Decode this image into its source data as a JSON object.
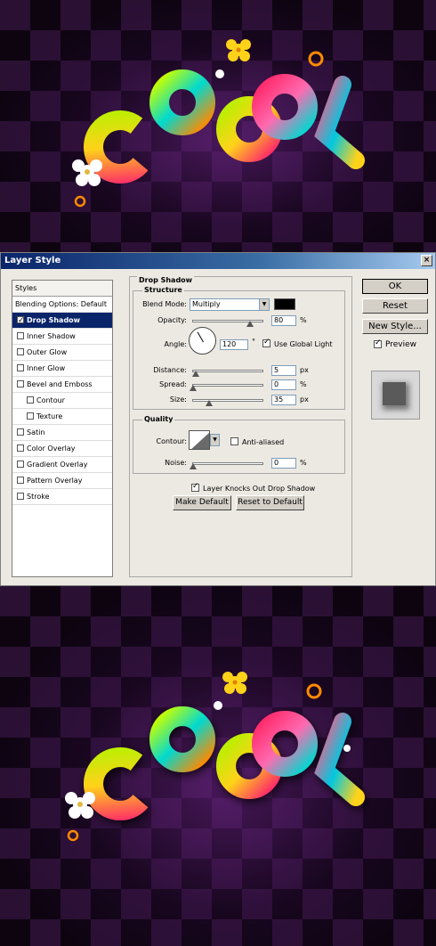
{
  "dialog": {
    "title": "Layer Style",
    "close_glyph": "×"
  },
  "styles_list": {
    "header": "Styles",
    "items": [
      {
        "label": "Blending Options: Default",
        "checkbox": false,
        "level": 0,
        "checked": false,
        "selected": false
      },
      {
        "label": "Drop Shadow",
        "checkbox": true,
        "level": 1,
        "checked": true,
        "selected": true
      },
      {
        "label": "Inner Shadow",
        "checkbox": true,
        "level": 1,
        "checked": false,
        "selected": false
      },
      {
        "label": "Outer Glow",
        "checkbox": true,
        "level": 1,
        "checked": false,
        "selected": false
      },
      {
        "label": "Inner Glow",
        "checkbox": true,
        "level": 1,
        "checked": false,
        "selected": false
      },
      {
        "label": "Bevel and Emboss",
        "checkbox": true,
        "level": 1,
        "checked": false,
        "selected": false
      },
      {
        "label": "Contour",
        "checkbox": true,
        "level": 2,
        "checked": false,
        "selected": false
      },
      {
        "label": "Texture",
        "checkbox": true,
        "level": 2,
        "checked": false,
        "selected": false
      },
      {
        "label": "Satin",
        "checkbox": true,
        "level": 1,
        "checked": false,
        "selected": false
      },
      {
        "label": "Color Overlay",
        "checkbox": true,
        "level": 1,
        "checked": false,
        "selected": false
      },
      {
        "label": "Gradient Overlay",
        "checkbox": true,
        "level": 1,
        "checked": false,
        "selected": false
      },
      {
        "label": "Pattern Overlay",
        "checkbox": true,
        "level": 1,
        "checked": false,
        "selected": false
      },
      {
        "label": "Stroke",
        "checkbox": true,
        "level": 1,
        "checked": false,
        "selected": false
      }
    ]
  },
  "drop_shadow": {
    "section_title": "Drop Shadow",
    "structure": {
      "title": "Structure",
      "blend_mode_label": "Blend Mode:",
      "blend_mode_value": "Multiply",
      "shadow_color": "#000000",
      "opacity_label": "Opacity:",
      "opacity_value": "80",
      "opacity_fraction": 0.8,
      "percent": "%",
      "angle_label": "Angle:",
      "angle_value": "120",
      "degree": "°",
      "use_global_light_label": "Use Global Light",
      "use_global_light": true,
      "distance_label": "Distance:",
      "distance_value": "5",
      "spread_label": "Spread:",
      "spread_value": "0",
      "size_label": "Size:",
      "size_value": "35",
      "px": "px"
    },
    "quality": {
      "title": "Quality",
      "contour_label": "Contour:",
      "anti_aliased_label": "Anti-aliased",
      "anti_aliased": false,
      "noise_label": "Noise:",
      "noise_value": "0",
      "percent": "%"
    },
    "layer_knocks_out_label": "Layer Knocks Out Drop Shadow",
    "layer_knocks_out": true,
    "make_default_label": "Make Default",
    "reset_to_default_label": "Reset to Default"
  },
  "right_panel": {
    "ok_label": "OK",
    "reset_label": "Reset",
    "new_style_label": "New Style...",
    "preview_label": "Preview",
    "preview_checked": true
  },
  "artwork": {
    "word_letters": [
      "C",
      "O",
      "O",
      "L"
    ],
    "colors": {
      "background_dark": "#0d0410",
      "background_purple": "#4a1a5c",
      "lime": "#b8f000",
      "cyan": "#00d9d0",
      "pink": "#ff2a6a",
      "orange": "#ff8a00",
      "yellow": "#ffd21a"
    }
  }
}
